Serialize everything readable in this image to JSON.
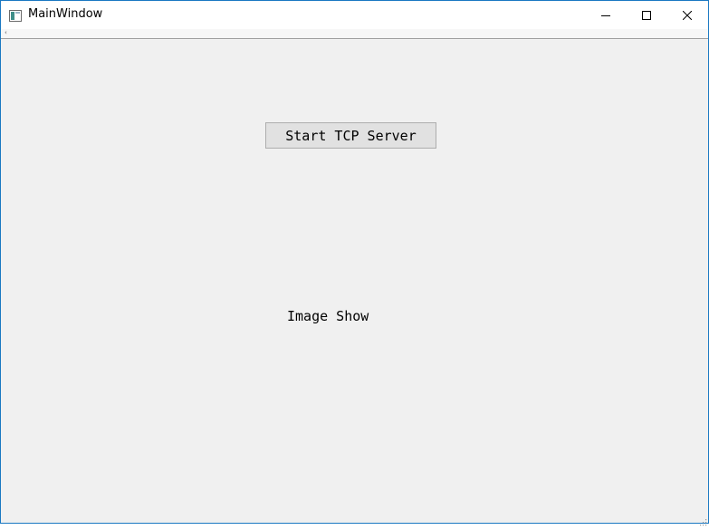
{
  "window": {
    "title": "MainWindow",
    "border_color": "#1a78c2",
    "background_color": "#f0f0f0"
  },
  "titlebar": {
    "app_icon": "window-app-icon",
    "minimize_icon": "minimize-icon",
    "maximize_icon": "maximize-icon",
    "close_icon": "close-icon"
  },
  "menubar": {
    "extension_glyph": "‹"
  },
  "main": {
    "start_button_label": "Start TCP Server",
    "image_label": "Image Show"
  },
  "statusbar": {
    "size_grip_icon": "size-grip-icon"
  }
}
